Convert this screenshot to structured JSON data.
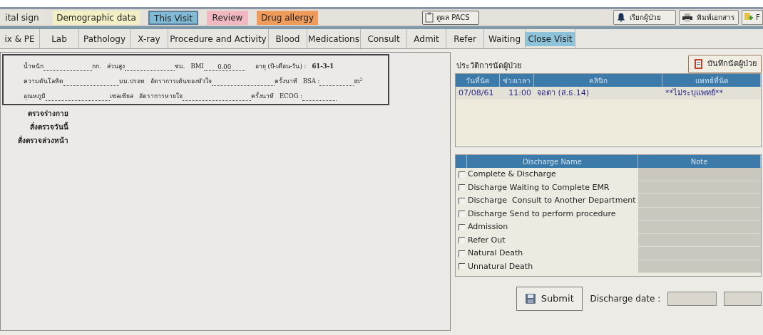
{
  "top_tabs": [
    {
      "label": "ital sign",
      "color": "#e6e3da",
      "selected": false
    },
    {
      "label": "Demographic data",
      "color": "#f3efc4",
      "selected": false
    },
    {
      "label": "This Visit",
      "color": "#80bad5",
      "selected": true
    },
    {
      "label": "Review",
      "color": "#f1b8c2",
      "selected": false
    },
    {
      "label": "Drug allergy",
      "color": "#ee9b5c",
      "selected": false
    }
  ],
  "pacs_button": {
    "label": "ดูผล PACS"
  },
  "call_patient_button": {
    "label": "เรียกผู้ป่วย"
  },
  "print_button": {
    "label": "พิมพ์เอกสาร"
  },
  "cut_button": {
    "label": "F"
  },
  "section_tabs": [
    {
      "label": "ix & PE",
      "selected": false
    },
    {
      "label": "Lab",
      "selected": false
    },
    {
      "label": "Pathology",
      "selected": false
    },
    {
      "label": "X-ray",
      "selected": false
    },
    {
      "label": "Procedure and Activity",
      "selected": false
    },
    {
      "label": "Blood",
      "selected": false
    },
    {
      "label": "Medications",
      "selected": false
    },
    {
      "label": "Consult",
      "selected": false
    },
    {
      "label": "Admit",
      "selected": false
    },
    {
      "label": "Refer",
      "selected": false
    },
    {
      "label": "Waiting",
      "selected": false
    },
    {
      "label": "Close Visit",
      "selected": true
    }
  ],
  "vitals": [
    [
      {
        "label": "น้ำหนัก",
        "unit": "กก."
      },
      {
        "label": "ส่วนสูง",
        "unit": "ซม."
      },
      {
        "label": "BMI",
        "value": "0.00"
      },
      {
        "label": "อายุ (ปี-เดือน-วัน) :",
        "value": "61-3-1",
        "kind": "plain"
      }
    ],
    [
      {
        "label": "ความดันโลหิต",
        "unit": "มม.ปรอท"
      },
      {
        "label": "อัตราการเต้นของหัวใจ",
        "unit": "ครั้งนาที"
      },
      {
        "label": "BSA :",
        "unit": "m$^{2}$"
      }
    ],
    [
      {
        "label": "อุณหภูมิ",
        "unit": "เซลเซียส"
      },
      {
        "label": "อัตราการหายใจ",
        "unit": "ครั้งนาที"
      },
      {
        "label": "ECOG :"
      }
    ]
  ],
  "exam_labels": [
    "ตรวจร่างกาย",
    "สั่งตรวจวันนี้",
    "สั่งตรวจล่วงหน้า"
  ],
  "appointments": {
    "title": "ประวัติการนัดผู้ป่วย",
    "save_button": "บันทึกนัดผู้ป่วย",
    "columns": [
      "วันที่นัด",
      "ช่วงเวลา",
      "คลินิก",
      "แพทย์ที่นัด"
    ],
    "rows": [
      [
        "07/08/61",
        "11:00",
        "จอตา (ส.ธ.14)",
        "**ไม่ระบุแพทย์**"
      ]
    ]
  },
  "discharge": {
    "columns": [
      "Discharge Name",
      "Note"
    ],
    "items": [
      {
        "label": "Complete & Discharge",
        "checked": false
      },
      {
        "label": "Discharge Waiting to Complete EMR",
        "checked": false
      },
      {
        "label": "Discharge  Consult to Another Department",
        "checked": false
      },
      {
        "label": "Discharge Send to perform procedure",
        "checked": false
      },
      {
        "label": "Admission",
        "checked": false
      },
      {
        "label": "Refer Out",
        "checked": false
      },
      {
        "label": "Natural Death",
        "checked": false
      },
      {
        "label": "Unnatural Death",
        "checked": false
      }
    ]
  },
  "submit_button": "Submit",
  "discharge_date_label": "Discharge date :"
}
